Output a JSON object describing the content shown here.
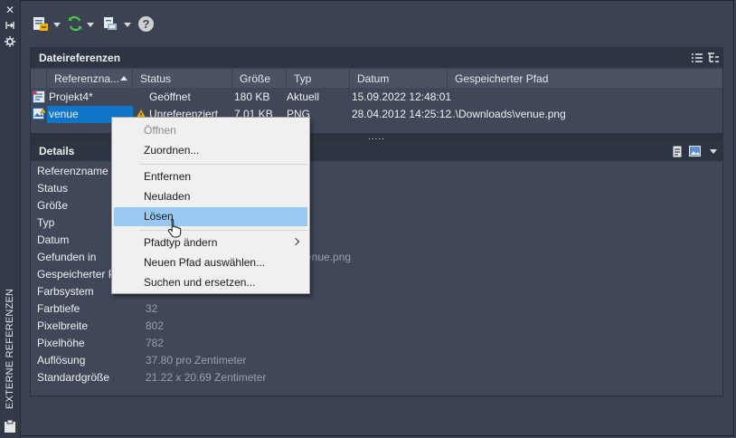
{
  "strip": {
    "label": "EXTERNE REFERENZEN",
    "buttons": [
      "close-icon",
      "auto-hide-icon",
      "properties-icon"
    ]
  },
  "toolbar": {
    "attach_icon": "attach-dwg-icon",
    "refresh_icon": "refresh-icon",
    "change_path_icon": "change-path-icon",
    "help_label": "?"
  },
  "refpanel": {
    "title": "Dateireferenzen",
    "columns": [
      "Referenzna...",
      "Status",
      "Größe",
      "Typ",
      "Datum",
      "Gespeicherter Pfad"
    ],
    "sort_column": "Referenzname",
    "rows": [
      {
        "name": "Projekt4*",
        "status": "Geöffnet",
        "size": "180 KB",
        "type": "Aktuell",
        "date": "15.09.2022 12:48:01",
        "path": ""
      },
      {
        "name": "venue",
        "status": "Unreferenziert",
        "size": "7.01 KB",
        "type": "PNG",
        "date": "28.04.2012 14:25:12",
        "path": "..\\Downloads\\venue.png"
      }
    ],
    "splitter": "....."
  },
  "details": {
    "title": "Details",
    "labels": [
      "Referenzname",
      "Status",
      "Größe",
      "Typ",
      "Datum",
      "Gefunden in",
      "Gespeicherter Pfad",
      "Farbsystem",
      "Farbtiefe",
      "Pixelbreite",
      "Pixelhöhe",
      "Auflösung",
      "Standardgröße"
    ],
    "found_in_value": "...venue.png",
    "color_depth": "32",
    "pixel_width": "802",
    "pixel_height": "782",
    "resolution": "37.80 pro Zentimeter",
    "default_size": "21.22 x 20.69 Zentimeter"
  },
  "context_menu": {
    "items": [
      {
        "label": "Öffnen",
        "disabled": true
      },
      {
        "label": "Zuordnen..."
      },
      {
        "label": "Entfernen"
      },
      {
        "label": "Neuladen"
      },
      {
        "label": "Lösen",
        "highlighted": true
      },
      {
        "label": "Pfadtyp ändern",
        "submenu": true
      },
      {
        "label": "Neuen Pfad auswählen..."
      },
      {
        "label": "Suchen und ersetzen..."
      }
    ]
  },
  "colors": {
    "background": "#3b4353",
    "panel": "#3f4758",
    "header": "#2e3542",
    "selection": "#0f75c9",
    "menu_highlight": "#99c9f3",
    "warning": "#f0b400"
  }
}
